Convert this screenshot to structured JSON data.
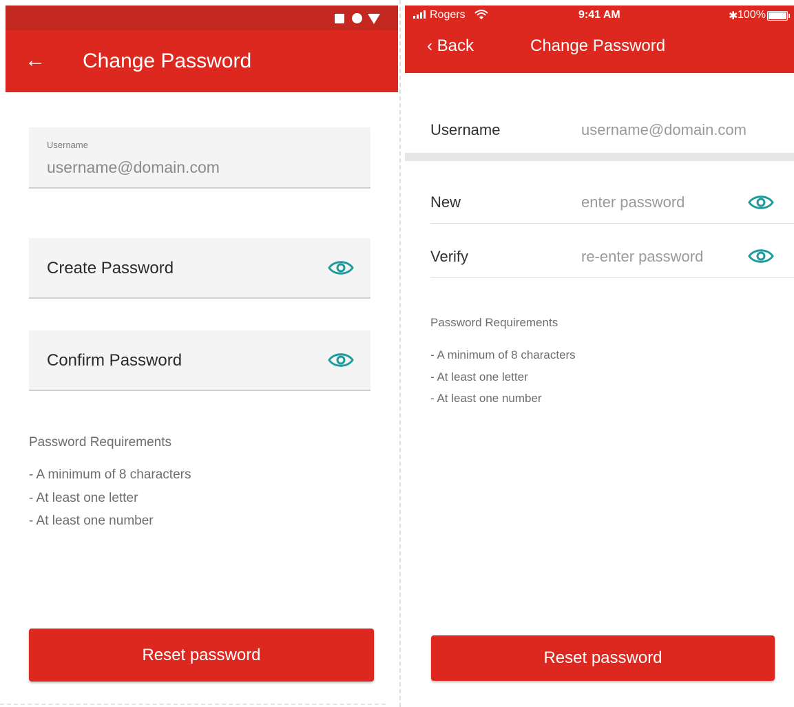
{
  "android": {
    "status_icons": [
      "square-icon",
      "circle-icon",
      "triangle-down-icon"
    ],
    "header": {
      "back_icon": "←",
      "title": "Change Password"
    },
    "username_field": {
      "label": "Username",
      "value": "username@domain.com"
    },
    "create_password_field": {
      "label": "Create Password",
      "icon": "eye-icon"
    },
    "confirm_password_field": {
      "label": "Confirm Password",
      "icon": "eye-icon"
    },
    "requirements": {
      "title": "Password Requirements",
      "items": [
        "- A minimum of 8 characters",
        "- At least one letter",
        "- At least one number"
      ]
    },
    "reset_button": "Reset password"
  },
  "ios": {
    "status": {
      "carrier": "Rogers",
      "time": "9:41 AM",
      "bluetooth": "✱",
      "battery": "100%"
    },
    "header": {
      "back_label": "‹  Back",
      "title": "Change Password"
    },
    "username": {
      "label": "Username",
      "value": "username@domain.com"
    },
    "new_password": {
      "label": "New",
      "placeholder": "enter password",
      "icon": "eye-icon"
    },
    "verify_password": {
      "label": "Verify",
      "placeholder": "re-enter password",
      "icon": "eye-icon"
    },
    "requirements": {
      "title": "Password Requirements",
      "items": [
        "- A minimum of 8 characters",
        "- At least one letter",
        "- At least one number"
      ]
    },
    "reset_button": "Reset password"
  },
  "colors": {
    "brand_red": "#dc281e",
    "status_red": "#c32820",
    "eye_teal": "#1f9b9b"
  }
}
